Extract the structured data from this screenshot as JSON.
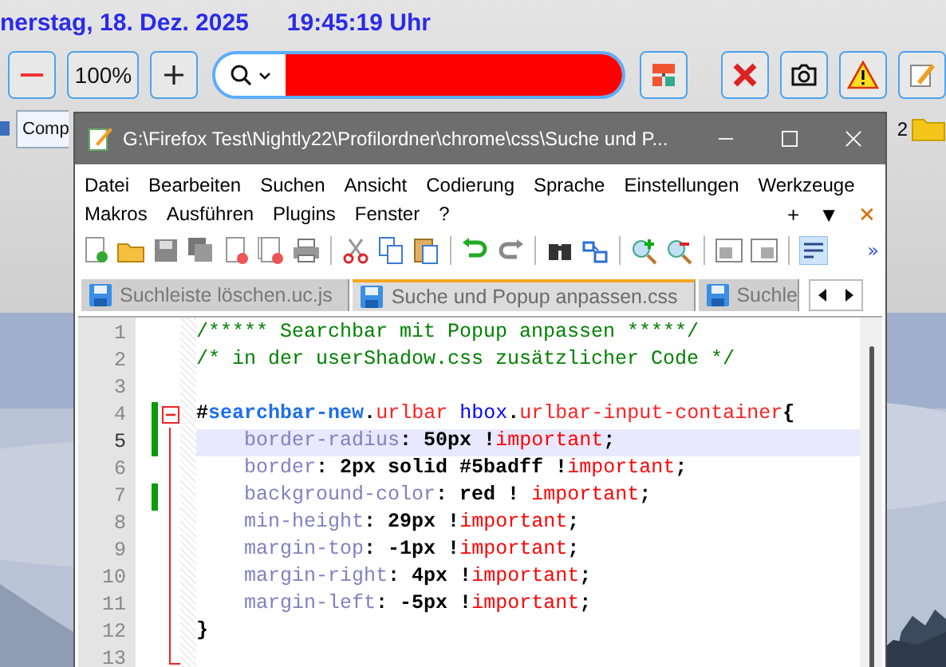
{
  "browser": {
    "date_text": "nerstag, 18. Dez. 2025",
    "time_text": "19:45:19 Uhr",
    "zoom_level": "100%",
    "search": {
      "filled": true
    },
    "bookmarks": [
      {
        "label": "Comp"
      }
    ],
    "bookmark_tail": "2"
  },
  "editor_window": {
    "title": "G:\\Firefox Test\\Nightly22\\Profilordner\\chrome\\css\\Suche und P...",
    "menu_rows": [
      [
        "Datei",
        "Bearbeiten",
        "Suchen",
        "Ansicht",
        "Codierung",
        "Sprache",
        "Einstellungen",
        "Werkzeuge"
      ],
      [
        "Makros",
        "Ausführen",
        "Plugins",
        "Fenster",
        "?"
      ]
    ],
    "menu_controls": [
      "+",
      "▼",
      "✕"
    ],
    "toolbar_overflow": "»",
    "tabs": [
      {
        "label": "Suchleiste löschen.uc.js",
        "selected": false
      },
      {
        "label": "Suche und Popup anpassen.css",
        "selected": true
      },
      {
        "label": "Suchle",
        "selected": false
      }
    ],
    "lines": [
      {
        "number": "1",
        "changed": false,
        "current": false,
        "tokens": [
          {
            "kind": "comment",
            "text": "/***** Searchbar mit Popup anpassen *****/"
          }
        ]
      },
      {
        "number": "2",
        "changed": false,
        "current": false,
        "tokens": [
          {
            "kind": "comment",
            "text": "/* in der userShadow.css zusätzlicher Code */"
          }
        ]
      },
      {
        "number": "3",
        "changed": false,
        "current": false
      },
      {
        "number": "4",
        "changed": true,
        "current": false,
        "expanded": true,
        "tokens": [
          {
            "kind": "punct",
            "text": "#"
          },
          {
            "kind": "id",
            "text": "searchbar-new"
          },
          {
            "kind": "punct",
            "text": "."
          },
          {
            "kind": "class",
            "text": "urlbar"
          },
          {
            "kind": "tag",
            "text": " hbox"
          },
          {
            "kind": "punct",
            "text": "."
          },
          {
            "kind": "class",
            "text": "urlbar-input-container"
          },
          {
            "kind": "punct",
            "text": "{"
          }
        ],
        "children": [
          {
            "number": "5",
            "changed": true,
            "current": true,
            "tokens": [
              {
                "kind": "property",
                "text": "    border-radius"
              },
              {
                "kind": "punct",
                "text": ": "
              },
              {
                "kind": "value",
                "text": "50px !"
              },
              {
                "kind": "important",
                "text": "important"
              },
              {
                "kind": "punct",
                "text": ";"
              }
            ]
          },
          {
            "number": "6",
            "changed": false,
            "current": false,
            "tokens": [
              {
                "kind": "property",
                "text": "    border"
              },
              {
                "kind": "punct",
                "text": ": "
              },
              {
                "kind": "value",
                "text": "2px solid #5badff !"
              },
              {
                "kind": "important",
                "text": "important"
              },
              {
                "kind": "punct",
                "text": ";"
              }
            ]
          },
          {
            "number": "7",
            "changed": true,
            "current": false,
            "tokens": [
              {
                "kind": "property",
                "text": "    background-color"
              },
              {
                "kind": "punct",
                "text": ": "
              },
              {
                "kind": "value",
                "text": "red ! "
              },
              {
                "kind": "important",
                "text": "important"
              },
              {
                "kind": "punct",
                "text": ";"
              }
            ]
          },
          {
            "number": "8",
            "changed": false,
            "current": false,
            "tokens": [
              {
                "kind": "property",
                "text": "    min-height"
              },
              {
                "kind": "punct",
                "text": ": "
              },
              {
                "kind": "value",
                "text": "29px !"
              },
              {
                "kind": "important",
                "text": "important"
              },
              {
                "kind": "punct",
                "text": ";"
              }
            ]
          },
          {
            "number": "9",
            "changed": false,
            "current": false,
            "tokens": [
              {
                "kind": "property",
                "text": "    margin-top"
              },
              {
                "kind": "punct",
                "text": ": "
              },
              {
                "kind": "value",
                "text": "-1px !"
              },
              {
                "kind": "important",
                "text": "important"
              },
              {
                "kind": "punct",
                "text": ";"
              }
            ]
          },
          {
            "number": "10",
            "changed": false,
            "current": false,
            "tokens": [
              {
                "kind": "property",
                "text": "    margin-right"
              },
              {
                "kind": "punct",
                "text": ": "
              },
              {
                "kind": "value",
                "text": "4px !"
              },
              {
                "kind": "important",
                "text": "important"
              },
              {
                "kind": "punct",
                "text": ";"
              }
            ]
          },
          {
            "number": "11",
            "changed": false,
            "current": false,
            "tokens": [
              {
                "kind": "property",
                "text": "    margin-left"
              },
              {
                "kind": "punct",
                "text": ": "
              },
              {
                "kind": "value",
                "text": "-5px !"
              },
              {
                "kind": "important",
                "text": "important"
              },
              {
                "kind": "punct",
                "text": ";"
              }
            ]
          },
          {
            "number": "12",
            "changed": false,
            "current": false,
            "tokens": [
              {
                "kind": "punct",
                "text": "}"
              }
            ]
          }
        ]
      },
      {
        "number": "13",
        "changed": false,
        "current": false
      }
    ]
  }
}
